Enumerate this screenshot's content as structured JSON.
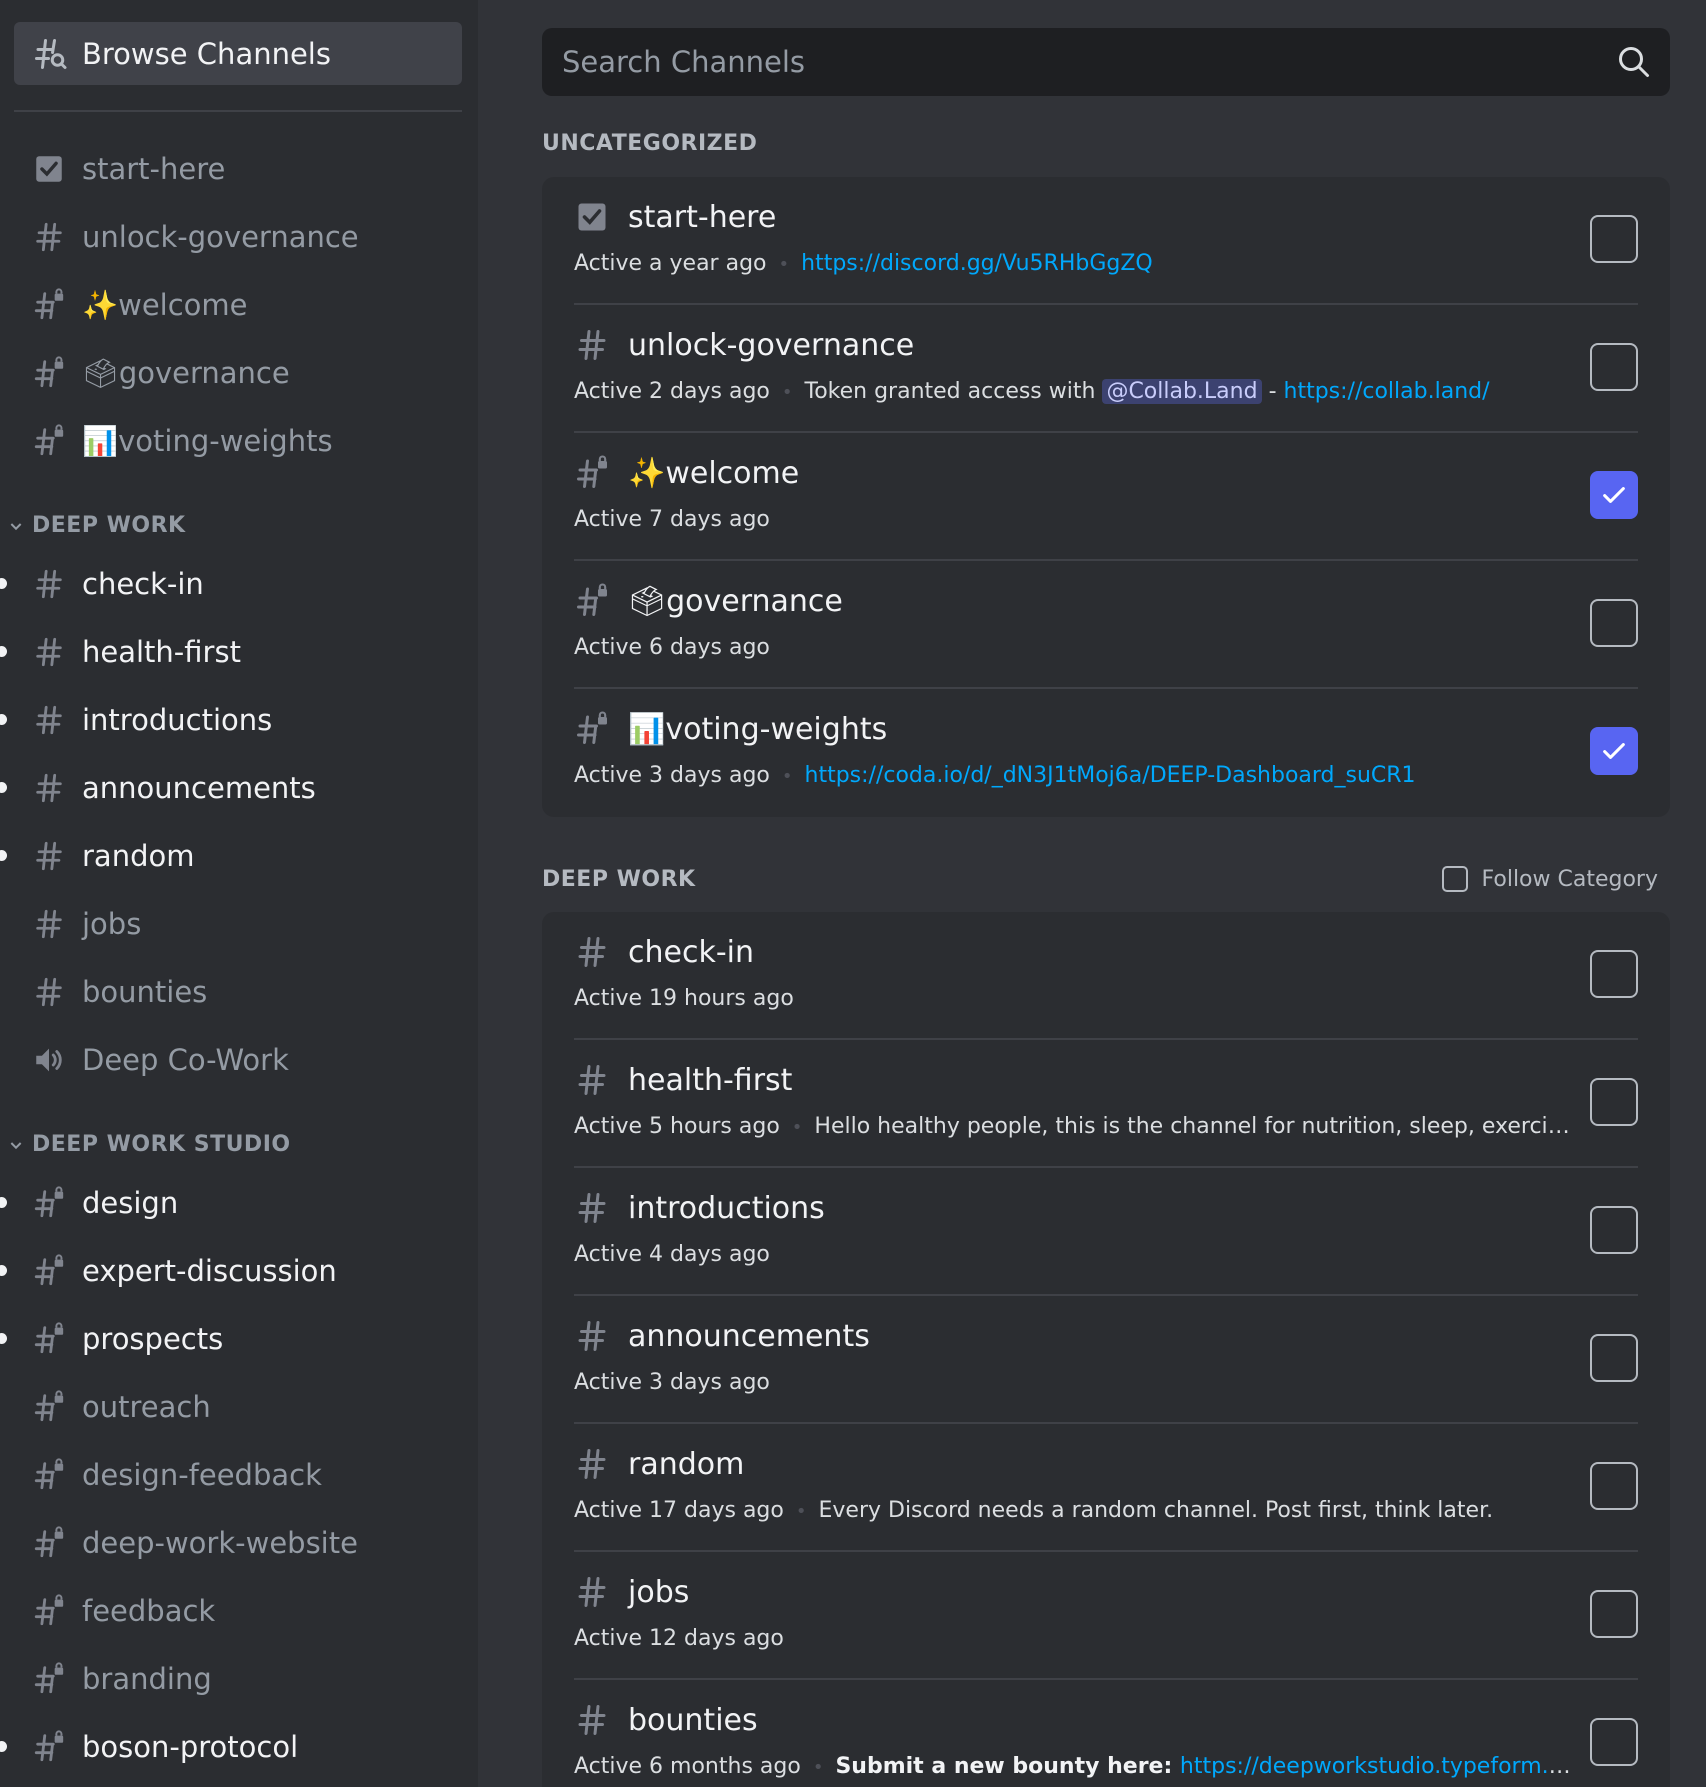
{
  "sidebar": {
    "browse_label": "Browse Channels",
    "top_items": [
      {
        "icon": "rules-icon",
        "label": "start-here"
      },
      {
        "icon": "hash-icon",
        "label": "unlock-governance"
      },
      {
        "icon": "hash-lock-icon",
        "label": "✨welcome"
      },
      {
        "icon": "hash-lock-icon",
        "label": "🗳governance"
      },
      {
        "icon": "hash-lock-icon",
        "label": "📊voting-weights"
      }
    ],
    "categories": [
      {
        "name": "DEEP WORK",
        "items": [
          {
            "icon": "hash-icon",
            "label": "check-in",
            "unread": true
          },
          {
            "icon": "hash-icon",
            "label": "health-first",
            "unread": true
          },
          {
            "icon": "hash-icon",
            "label": "introductions",
            "unread": true
          },
          {
            "icon": "hash-icon",
            "label": "announcements",
            "unread": true
          },
          {
            "icon": "hash-icon",
            "label": "random",
            "unread": true
          },
          {
            "icon": "hash-icon",
            "label": "jobs",
            "unread": false
          },
          {
            "icon": "hash-icon",
            "label": "bounties",
            "unread": false
          },
          {
            "icon": "speaker-icon",
            "label": "Deep Co-Work",
            "unread": false
          }
        ]
      },
      {
        "name": "DEEP WORK STUDIO",
        "items": [
          {
            "icon": "hash-lock-icon",
            "label": "design",
            "unread": true
          },
          {
            "icon": "hash-lock-icon",
            "label": "expert-discussion",
            "unread": true
          },
          {
            "icon": "hash-lock-icon",
            "label": "prospects",
            "unread": true
          },
          {
            "icon": "hash-lock-icon",
            "label": "outreach",
            "unread": false
          },
          {
            "icon": "hash-lock-icon",
            "label": "design-feedback",
            "unread": false
          },
          {
            "icon": "hash-lock-icon",
            "label": "deep-work-website",
            "unread": false
          },
          {
            "icon": "hash-lock-icon",
            "label": "feedback",
            "unread": false
          },
          {
            "icon": "hash-lock-icon",
            "label": "branding",
            "unread": false
          },
          {
            "icon": "hash-lock-icon",
            "label": "boson-protocol",
            "unread": true
          }
        ]
      }
    ]
  },
  "main": {
    "search_placeholder": "Search Channels",
    "uncategorized_label": "UNCATEGORIZED",
    "deep_work_label": "DEEP WORK",
    "follow_category_label": "Follow Category",
    "uncategorized": [
      {
        "icon": "rules-icon",
        "name": "start-here",
        "active": "Active a year ago",
        "link": "https://discord.gg/Vu5RHbGgZQ",
        "checked": false
      },
      {
        "icon": "hash-icon",
        "name": "unlock-governance",
        "active": "Active 2 days ago",
        "text": "Token granted access with ",
        "mention": "@Collab.Land",
        "text2": " - ",
        "link": "https://collab.land/",
        "checked": false
      },
      {
        "icon": "hash-lock-icon",
        "name": "✨welcome",
        "active": "Active 7 days ago",
        "checked": true
      },
      {
        "icon": "hash-lock-icon",
        "name": "🗳governance",
        "active": "Active 6 days ago",
        "checked": false
      },
      {
        "icon": "hash-lock-icon",
        "name": "📊voting-weights",
        "active": "Active 3 days ago",
        "link": "https://coda.io/d/_dN3J1tMoj6a/DEEP-Dashboard_suCR1",
        "checked": true
      }
    ],
    "deep_work": [
      {
        "icon": "hash-icon",
        "name": "check-in",
        "active": "Active 19 hours ago",
        "checked": false
      },
      {
        "icon": "hash-icon",
        "name": "health-first",
        "active": "Active 5 hours ago",
        "text": "Hello healthy people, this is the channel for nutrition, sleep, exercise and...",
        "checked": false
      },
      {
        "icon": "hash-icon",
        "name": "introductions",
        "active": "Active 4 days ago",
        "checked": false
      },
      {
        "icon": "hash-icon",
        "name": "announcements",
        "active": "Active 3 days ago",
        "checked": false
      },
      {
        "icon": "hash-icon",
        "name": "random",
        "active": "Active 17 days ago",
        "text": "Every Discord needs a random channel. Post first, think later.",
        "checked": false
      },
      {
        "icon": "hash-icon",
        "name": "jobs",
        "active": "Active 12 days ago",
        "checked": false
      },
      {
        "icon": "hash-icon",
        "name": "bounties",
        "active": "Active 6 months ago",
        "bold": "Submit a new bounty here: ",
        "link": "https://deepworkstudio.typeform.com/to/...",
        "checked": false
      }
    ]
  },
  "colors": {
    "accent": "#5865f2",
    "link": "#00a8fc",
    "sidebar_bg": "#2b2d31",
    "main_bg": "#313338"
  }
}
